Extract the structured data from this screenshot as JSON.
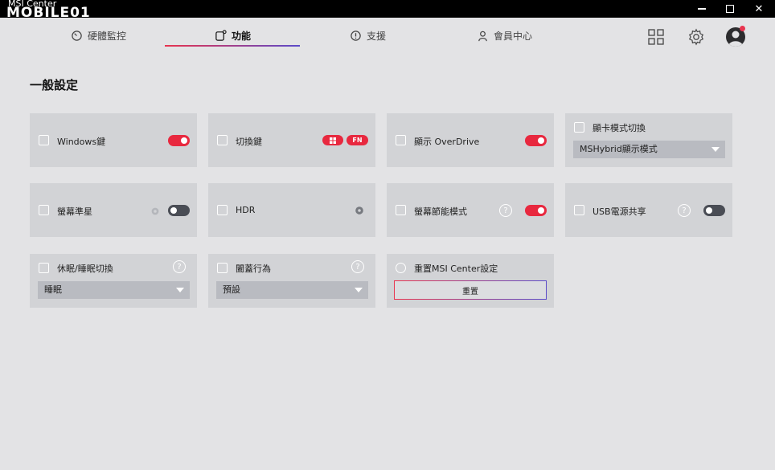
{
  "window": {
    "app_title": "MSI Center",
    "watermark": "MOBILE01"
  },
  "nav": {
    "tabs": [
      {
        "label": "硬體監控",
        "icon": "gauge-icon"
      },
      {
        "label": "功能",
        "icon": "feature-icon",
        "active": true
      },
      {
        "label": "支援",
        "icon": "support-icon"
      },
      {
        "label": "會員中心",
        "icon": "user-icon"
      }
    ],
    "accent_gradient": [
      "#e8344f",
      "#5b4bc9"
    ]
  },
  "section": {
    "title": "一般設定"
  },
  "cards": {
    "windows_key": {
      "label": "Windows鍵",
      "toggle": "on"
    },
    "switch_key": {
      "label": "切換鍵",
      "pill_fn": "FN"
    },
    "overdrive": {
      "label": "顯示 OverDrive",
      "toggle": "on"
    },
    "gpu_mode": {
      "label": "顯卡模式切換",
      "select_value": "MSHybrid顯示模式"
    },
    "crosshair": {
      "label": "螢幕準星",
      "toggle": "off"
    },
    "hdr": {
      "label": "HDR"
    },
    "eco_mode": {
      "label": "螢幕節能模式",
      "help": "?",
      "toggle": "on"
    },
    "usb_power": {
      "label": "USB電源共享",
      "help": "?",
      "toggle": "off"
    },
    "sleep": {
      "label": "休眠/睡眠切換",
      "help": "?",
      "select_value": "睡眠"
    },
    "lid": {
      "label": "闔蓋行為",
      "help": "?",
      "select_value": "預設"
    },
    "reset": {
      "label": "重置MSI Center設定",
      "button": "重置"
    }
  },
  "colors": {
    "toggle_on": "#e8283f",
    "toggle_off": "#4a4d55",
    "background": "#e3e3e5",
    "card": "#d2d3d6"
  }
}
